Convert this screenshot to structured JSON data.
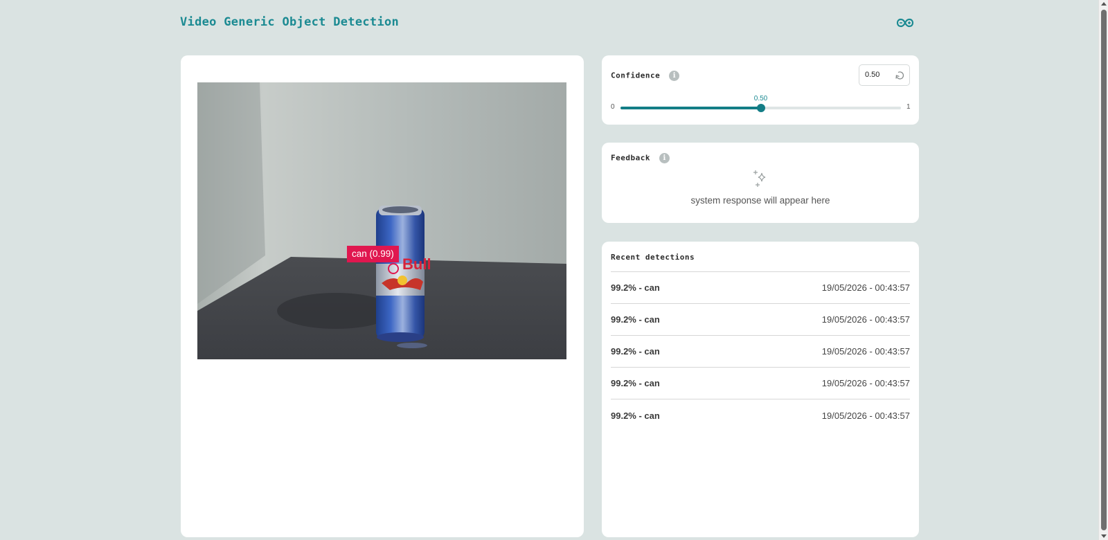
{
  "header": {
    "title": "Video Generic Object Detection",
    "logo_icon": "infinity-logo-icon"
  },
  "video": {
    "detection_label": "can (0.99)",
    "detection_color": "#e0174f"
  },
  "confidence": {
    "title": "Confidence",
    "info_icon": "i",
    "input_value": "0.50",
    "slider_min": "0",
    "slider_max": "1",
    "slider_value_label": "0.50",
    "slider_value": 0.5,
    "accent_color": "#137d86"
  },
  "feedback": {
    "title": "Feedback",
    "info_icon": "i",
    "placeholder": "system response will appear here",
    "icon": "sparkle-icon"
  },
  "recent": {
    "title": "Recent detections",
    "items": [
      {
        "label": "99.2% - can",
        "time": "19/05/2026 - 00:43:57"
      },
      {
        "label": "99.2% - can",
        "time": "19/05/2026 - 00:43:57"
      },
      {
        "label": "99.2% - can",
        "time": "19/05/2026 - 00:43:57"
      },
      {
        "label": "99.2% - can",
        "time": "19/05/2026 - 00:43:57"
      },
      {
        "label": "99.2% - can",
        "time": "19/05/2026 - 00:43:57"
      }
    ]
  }
}
